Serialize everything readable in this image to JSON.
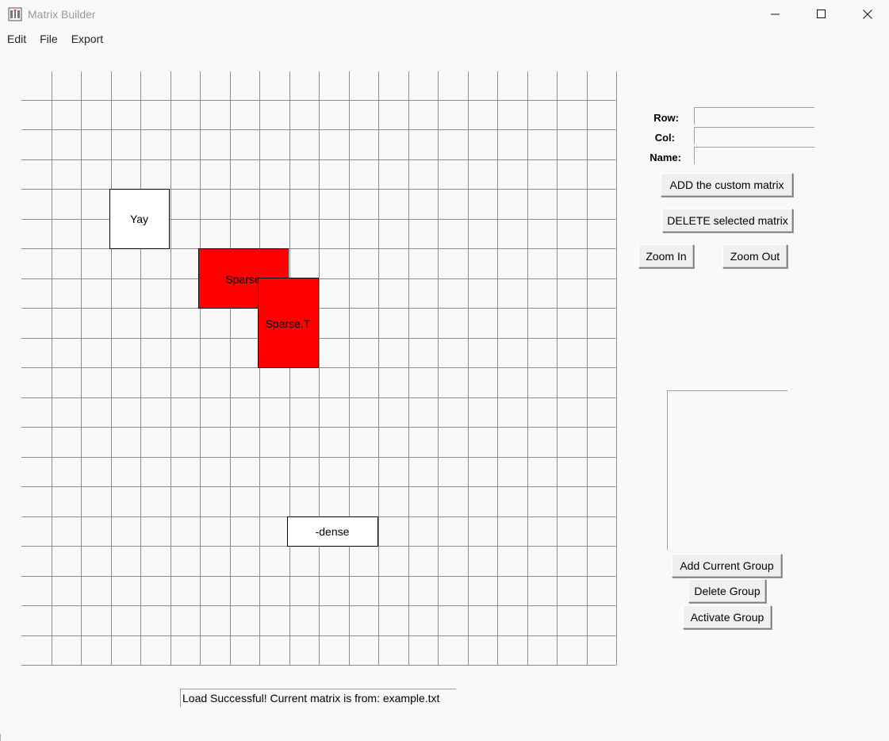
{
  "window": {
    "title": "Matrix Builder",
    "icon": "app-icon"
  },
  "menu": {
    "items": [
      "Edit",
      "File",
      "Export"
    ]
  },
  "canvas": {
    "grid_columns": 20,
    "grid_rows": 20,
    "matrices": [
      {
        "name": "Yay",
        "fill": "#ffffff"
      },
      {
        "name": "Sparse",
        "fill": "#ff0000"
      },
      {
        "name": "Sparse.T",
        "fill": "#ff0000"
      },
      {
        "name": "-dense",
        "fill": "#ffffff"
      }
    ]
  },
  "form": {
    "row_label": "Row:",
    "col_label": "Col:",
    "name_label": "Name:",
    "row_value": "",
    "col_value": "",
    "name_value": ""
  },
  "buttons": {
    "add_matrix": "ADD the custom matrix",
    "delete_matrix": "DELETE selected matrix",
    "zoom_in": "Zoom In",
    "zoom_out": "Zoom Out",
    "add_group": "Add Current Group",
    "delete_group": "Delete Group",
    "activate_group": "Activate Group"
  },
  "groups": {
    "items": []
  },
  "status": {
    "text": "Load Successful! Current matrix is from: example.txt"
  },
  "colors": {
    "background": "#f9f9f9",
    "grid_line": "#8c8c8c",
    "matrix_highlight": "#ff0000"
  }
}
